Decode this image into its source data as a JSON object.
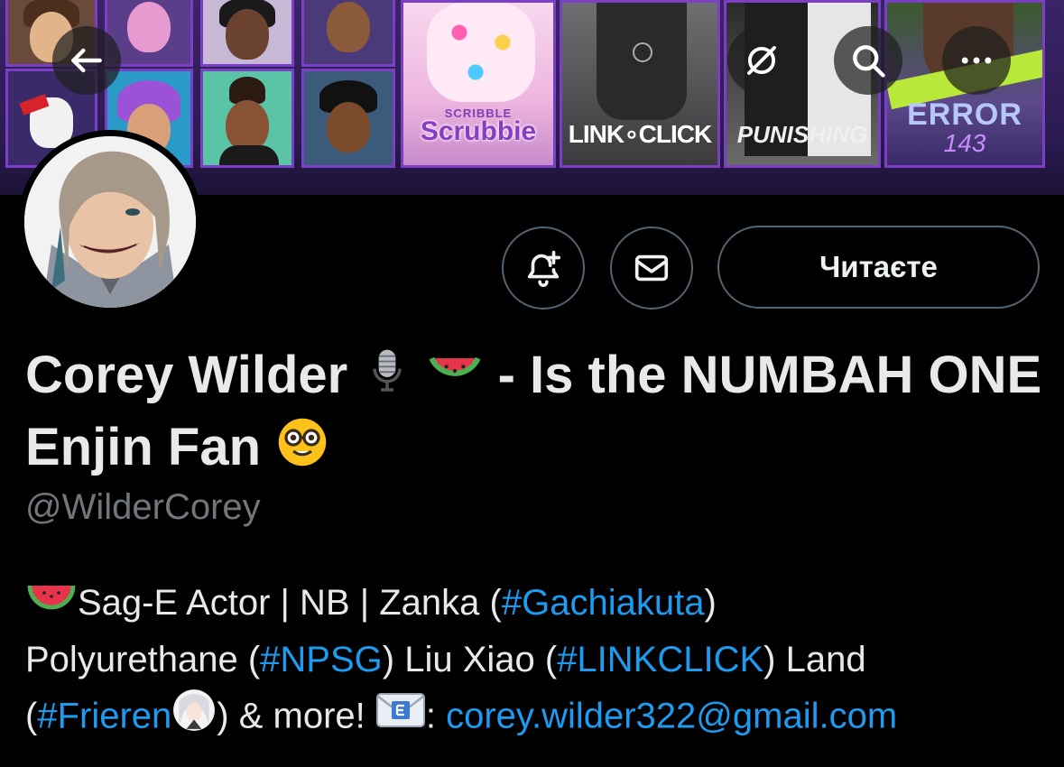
{
  "banner": {
    "posters": [
      {
        "id": "scribble",
        "title_top": "SCRIBBLE",
        "title_main": "Scrubbie"
      },
      {
        "id": "linkclick",
        "title": "LINK∘CLICK"
      },
      {
        "id": "punishing",
        "title": "PUNISHING"
      },
      {
        "id": "error",
        "title_main": "ERROR",
        "title_num": "143"
      }
    ]
  },
  "nav": {
    "back_icon": "arrow-left-icon",
    "grok_icon": "grok-icon",
    "search_icon": "search-icon",
    "more_icon": "more-horizontal-icon"
  },
  "actions": {
    "notify_icon": "bell-plus-icon",
    "message_icon": "envelope-icon",
    "follow_label": "Читаєте"
  },
  "profile": {
    "name_part1": "Corey Wilder",
    "name_part2": "- Is the NUMBAH ONE Enjin Fan",
    "name_emojis": [
      "microphone",
      "watermelon",
      "nerd-face"
    ],
    "handle": "@WilderCorey"
  },
  "bio": {
    "line1_text": "Sag-E Actor | NB | Zanka (",
    "hashtag1": "#Gachiakuta",
    "line1_end": ")",
    "line2_start": "Polyurethane (",
    "hashtag2": "#NPSG",
    "line2_mid": ") Liu Xiao (",
    "hashtag3": "#LINKCLICK",
    "line2_end": ") Land",
    "line3_start": "(",
    "hashtag4": "#Frieren",
    "line3_mid": ") & more! ",
    "line3_colon": ": ",
    "email": "corey.wilder322@gmail.com"
  },
  "colors": {
    "link": "#1d9bf0",
    "handle": "#71767b",
    "button_border": "#536471",
    "banner_border": "#7a3fc4"
  }
}
